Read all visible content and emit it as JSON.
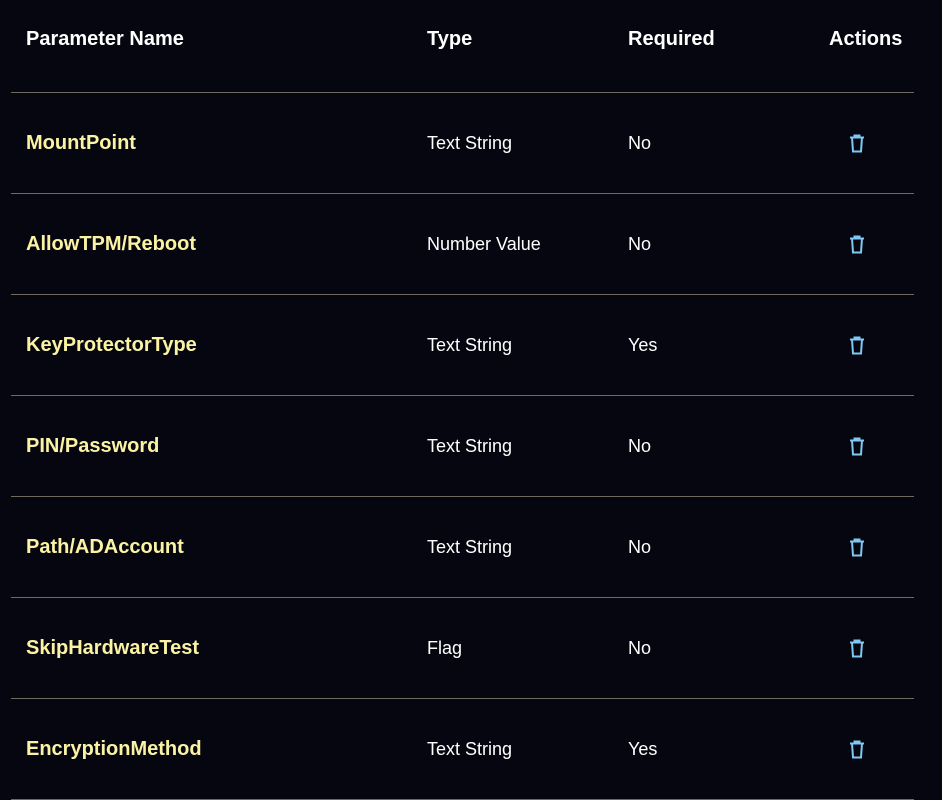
{
  "table": {
    "headers": {
      "name": "Parameter Name",
      "type": "Type",
      "required": "Required",
      "actions": "Actions"
    },
    "rows": [
      {
        "name": "MountPoint",
        "type": "Text String",
        "required": "No",
        "action_icon": "trash-icon"
      },
      {
        "name": "AllowTPM/Reboot",
        "type": "Number Value",
        "required": "No",
        "action_icon": "trash-icon"
      },
      {
        "name": "KeyProtectorType",
        "type": "Text String",
        "required": "Yes",
        "action_icon": "trash-icon"
      },
      {
        "name": "PIN/Password",
        "type": "Text String",
        "required": "No",
        "action_icon": "trash-icon"
      },
      {
        "name": "Path/ADAccount",
        "type": "Text String",
        "required": "No",
        "action_icon": "trash-icon"
      },
      {
        "name": "SkipHardwareTest",
        "type": "Flag",
        "required": "No",
        "action_icon": "trash-icon"
      },
      {
        "name": "EncryptionMethod",
        "type": "Text String",
        "required": "Yes",
        "action_icon": "trash-icon"
      }
    ]
  },
  "colors": {
    "background": "#05060f",
    "name_text": "#fbf3a3",
    "icon": "#7ec8f2",
    "divider": "#6e6a5e"
  }
}
